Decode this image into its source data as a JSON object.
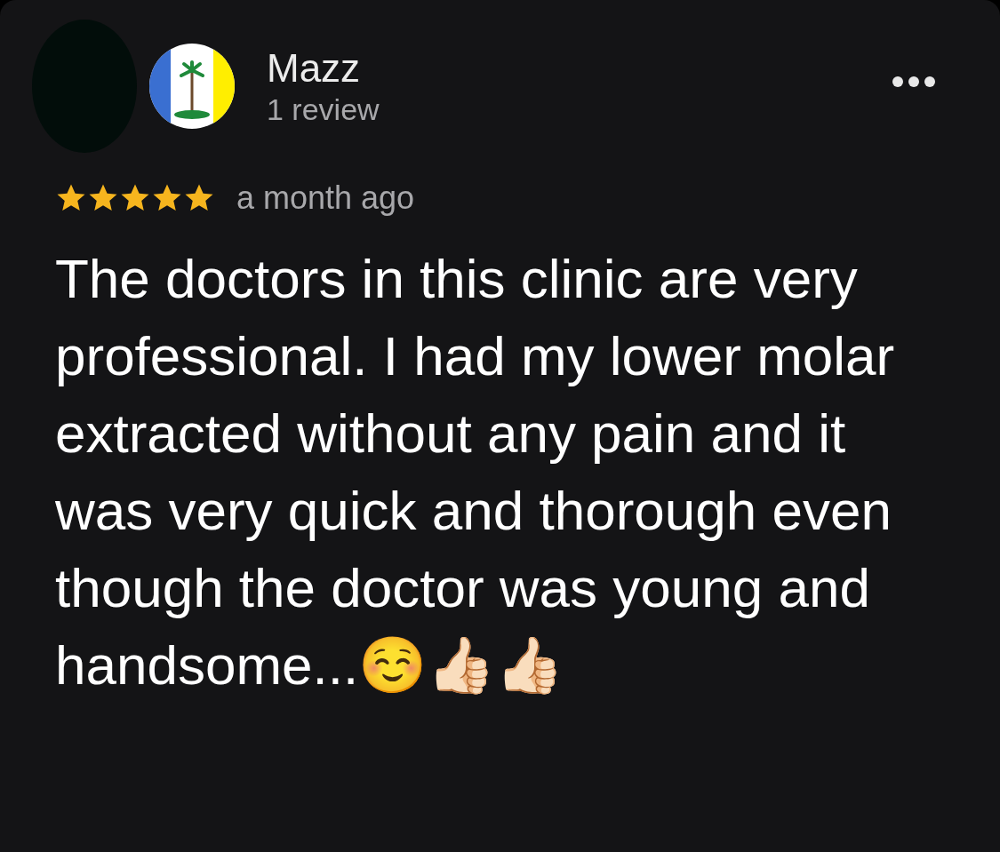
{
  "reviewer": {
    "name": "Mazz",
    "review_count": "1 review"
  },
  "review": {
    "stars": 5,
    "time": "a month ago",
    "text": "The doctors in this clinic are very professional. I had my lower molar extracted without any pain and it was very quick and thorough even though the doctor was young and handsome...☺️👍🏻👍🏻"
  }
}
